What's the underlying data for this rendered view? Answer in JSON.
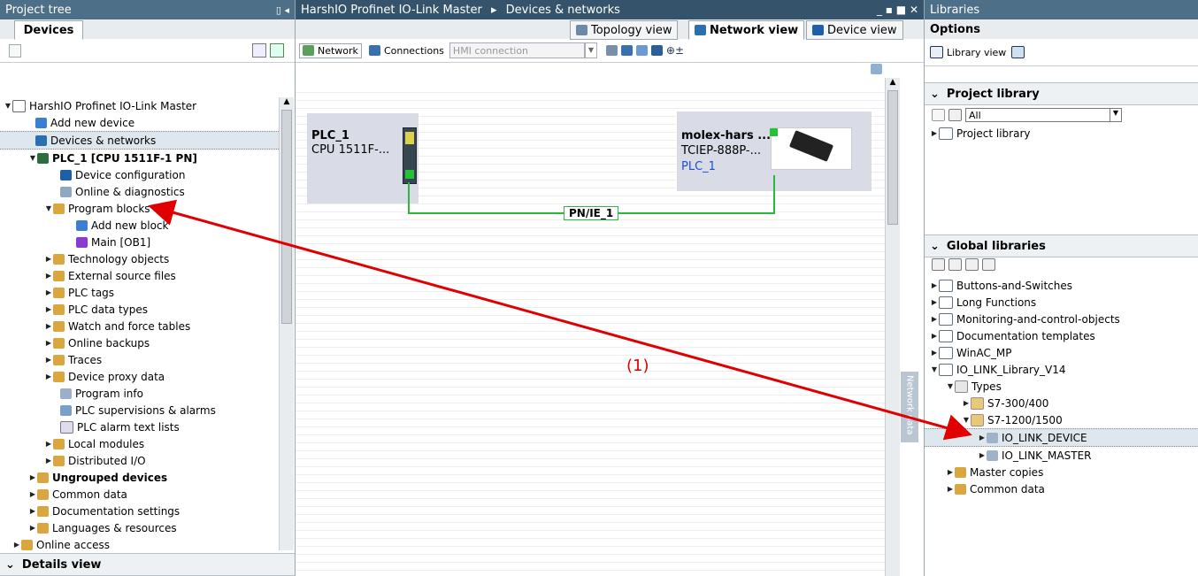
{
  "project_tree": {
    "title": "Project tree",
    "devices_tab": "Devices",
    "items": [
      {
        "label": "HarshIO Profinet IO-Link Master"
      },
      {
        "label": "Add new device"
      },
      {
        "label": "Devices & networks"
      },
      {
        "label": "PLC_1 [CPU 1511F-1 PN]"
      },
      {
        "label": "Device configuration"
      },
      {
        "label": "Online & diagnostics"
      },
      {
        "label": "Program blocks"
      },
      {
        "label": "Add new block"
      },
      {
        "label": "Main [OB1]"
      },
      {
        "label": "Technology objects"
      },
      {
        "label": "External source files"
      },
      {
        "label": "PLC tags"
      },
      {
        "label": "PLC data types"
      },
      {
        "label": "Watch and force tables"
      },
      {
        "label": "Online backups"
      },
      {
        "label": "Traces"
      },
      {
        "label": "Device proxy data"
      },
      {
        "label": "Program info"
      },
      {
        "label": "PLC supervisions & alarms"
      },
      {
        "label": "PLC alarm text lists"
      },
      {
        "label": "Local modules"
      },
      {
        "label": "Distributed I/O"
      },
      {
        "label": "Ungrouped devices"
      },
      {
        "label": "Common data"
      },
      {
        "label": "Documentation settings"
      },
      {
        "label": "Languages & resources"
      },
      {
        "label": "Online access"
      }
    ],
    "details_view": "Details view"
  },
  "editor": {
    "title": "HarshIO Profinet IO-Link Master",
    "breadcrumb_sep": "▸",
    "breadcrumb_current": "Devices & networks",
    "views": {
      "topology": "Topology view",
      "network": "Network view",
      "device": "Device view"
    },
    "toolbar": {
      "network": "Network",
      "connections": "Connections",
      "hmi_connection": "HMI connection"
    },
    "plc_box": {
      "name": "PLC_1",
      "type": "CPU 1511F-..."
    },
    "device_box": {
      "name": "molex-hars ...",
      "type": "TCIEP-888P-...",
      "link": "PLC_1"
    },
    "network_label": "PN/IE_1",
    "annotation": "(1)",
    "side_tab": "Network data"
  },
  "libraries": {
    "title": "Libraries",
    "options": "Options",
    "library_view": "Library view",
    "project_library_header": "Project library",
    "filter_value": "All",
    "project_library_item": "Project library",
    "global_libraries_header": "Global libraries",
    "items": [
      {
        "label": "Buttons-and-Switches"
      },
      {
        "label": "Long Functions"
      },
      {
        "label": "Monitoring-and-control-objects"
      },
      {
        "label": "Documentation templates"
      },
      {
        "label": "WinAC_MP"
      },
      {
        "label": "IO_LINK_Library_V14"
      },
      {
        "label": "Types"
      },
      {
        "label": "S7-300/400"
      },
      {
        "label": "S7-1200/1500"
      },
      {
        "label": "IO_LINK_DEVICE"
      },
      {
        "label": "IO_LINK_MASTER"
      },
      {
        "label": "Master copies"
      },
      {
        "label": "Common data"
      }
    ]
  },
  "colors": {
    "arrow": "#e00000",
    "network_line": "#2db83d",
    "titlebar": "#4d7088"
  }
}
